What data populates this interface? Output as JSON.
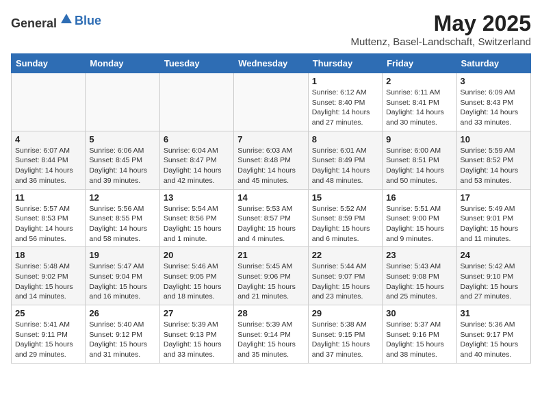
{
  "header": {
    "logo_general": "General",
    "logo_blue": "Blue",
    "month": "May 2025",
    "location": "Muttenz, Basel-Landschaft, Switzerland"
  },
  "weekdays": [
    "Sunday",
    "Monday",
    "Tuesday",
    "Wednesday",
    "Thursday",
    "Friday",
    "Saturday"
  ],
  "weeks": [
    [
      {
        "day": "",
        "info": ""
      },
      {
        "day": "",
        "info": ""
      },
      {
        "day": "",
        "info": ""
      },
      {
        "day": "",
        "info": ""
      },
      {
        "day": "1",
        "info": "Sunrise: 6:12 AM\nSunset: 8:40 PM\nDaylight: 14 hours\nand 27 minutes."
      },
      {
        "day": "2",
        "info": "Sunrise: 6:11 AM\nSunset: 8:41 PM\nDaylight: 14 hours\nand 30 minutes."
      },
      {
        "day": "3",
        "info": "Sunrise: 6:09 AM\nSunset: 8:43 PM\nDaylight: 14 hours\nand 33 minutes."
      }
    ],
    [
      {
        "day": "4",
        "info": "Sunrise: 6:07 AM\nSunset: 8:44 PM\nDaylight: 14 hours\nand 36 minutes."
      },
      {
        "day": "5",
        "info": "Sunrise: 6:06 AM\nSunset: 8:45 PM\nDaylight: 14 hours\nand 39 minutes."
      },
      {
        "day": "6",
        "info": "Sunrise: 6:04 AM\nSunset: 8:47 PM\nDaylight: 14 hours\nand 42 minutes."
      },
      {
        "day": "7",
        "info": "Sunrise: 6:03 AM\nSunset: 8:48 PM\nDaylight: 14 hours\nand 45 minutes."
      },
      {
        "day": "8",
        "info": "Sunrise: 6:01 AM\nSunset: 8:49 PM\nDaylight: 14 hours\nand 48 minutes."
      },
      {
        "day": "9",
        "info": "Sunrise: 6:00 AM\nSunset: 8:51 PM\nDaylight: 14 hours\nand 50 minutes."
      },
      {
        "day": "10",
        "info": "Sunrise: 5:59 AM\nSunset: 8:52 PM\nDaylight: 14 hours\nand 53 minutes."
      }
    ],
    [
      {
        "day": "11",
        "info": "Sunrise: 5:57 AM\nSunset: 8:53 PM\nDaylight: 14 hours\nand 56 minutes."
      },
      {
        "day": "12",
        "info": "Sunrise: 5:56 AM\nSunset: 8:55 PM\nDaylight: 14 hours\nand 58 minutes."
      },
      {
        "day": "13",
        "info": "Sunrise: 5:54 AM\nSunset: 8:56 PM\nDaylight: 15 hours\nand 1 minute."
      },
      {
        "day": "14",
        "info": "Sunrise: 5:53 AM\nSunset: 8:57 PM\nDaylight: 15 hours\nand 4 minutes."
      },
      {
        "day": "15",
        "info": "Sunrise: 5:52 AM\nSunset: 8:59 PM\nDaylight: 15 hours\nand 6 minutes."
      },
      {
        "day": "16",
        "info": "Sunrise: 5:51 AM\nSunset: 9:00 PM\nDaylight: 15 hours\nand 9 minutes."
      },
      {
        "day": "17",
        "info": "Sunrise: 5:49 AM\nSunset: 9:01 PM\nDaylight: 15 hours\nand 11 minutes."
      }
    ],
    [
      {
        "day": "18",
        "info": "Sunrise: 5:48 AM\nSunset: 9:02 PM\nDaylight: 15 hours\nand 14 minutes."
      },
      {
        "day": "19",
        "info": "Sunrise: 5:47 AM\nSunset: 9:04 PM\nDaylight: 15 hours\nand 16 minutes."
      },
      {
        "day": "20",
        "info": "Sunrise: 5:46 AM\nSunset: 9:05 PM\nDaylight: 15 hours\nand 18 minutes."
      },
      {
        "day": "21",
        "info": "Sunrise: 5:45 AM\nSunset: 9:06 PM\nDaylight: 15 hours\nand 21 minutes."
      },
      {
        "day": "22",
        "info": "Sunrise: 5:44 AM\nSunset: 9:07 PM\nDaylight: 15 hours\nand 23 minutes."
      },
      {
        "day": "23",
        "info": "Sunrise: 5:43 AM\nSunset: 9:08 PM\nDaylight: 15 hours\nand 25 minutes."
      },
      {
        "day": "24",
        "info": "Sunrise: 5:42 AM\nSunset: 9:10 PM\nDaylight: 15 hours\nand 27 minutes."
      }
    ],
    [
      {
        "day": "25",
        "info": "Sunrise: 5:41 AM\nSunset: 9:11 PM\nDaylight: 15 hours\nand 29 minutes."
      },
      {
        "day": "26",
        "info": "Sunrise: 5:40 AM\nSunset: 9:12 PM\nDaylight: 15 hours\nand 31 minutes."
      },
      {
        "day": "27",
        "info": "Sunrise: 5:39 AM\nSunset: 9:13 PM\nDaylight: 15 hours\nand 33 minutes."
      },
      {
        "day": "28",
        "info": "Sunrise: 5:39 AM\nSunset: 9:14 PM\nDaylight: 15 hours\nand 35 minutes."
      },
      {
        "day": "29",
        "info": "Sunrise: 5:38 AM\nSunset: 9:15 PM\nDaylight: 15 hours\nand 37 minutes."
      },
      {
        "day": "30",
        "info": "Sunrise: 5:37 AM\nSunset: 9:16 PM\nDaylight: 15 hours\nand 38 minutes."
      },
      {
        "day": "31",
        "info": "Sunrise: 5:36 AM\nSunset: 9:17 PM\nDaylight: 15 hours\nand 40 minutes."
      }
    ]
  ]
}
